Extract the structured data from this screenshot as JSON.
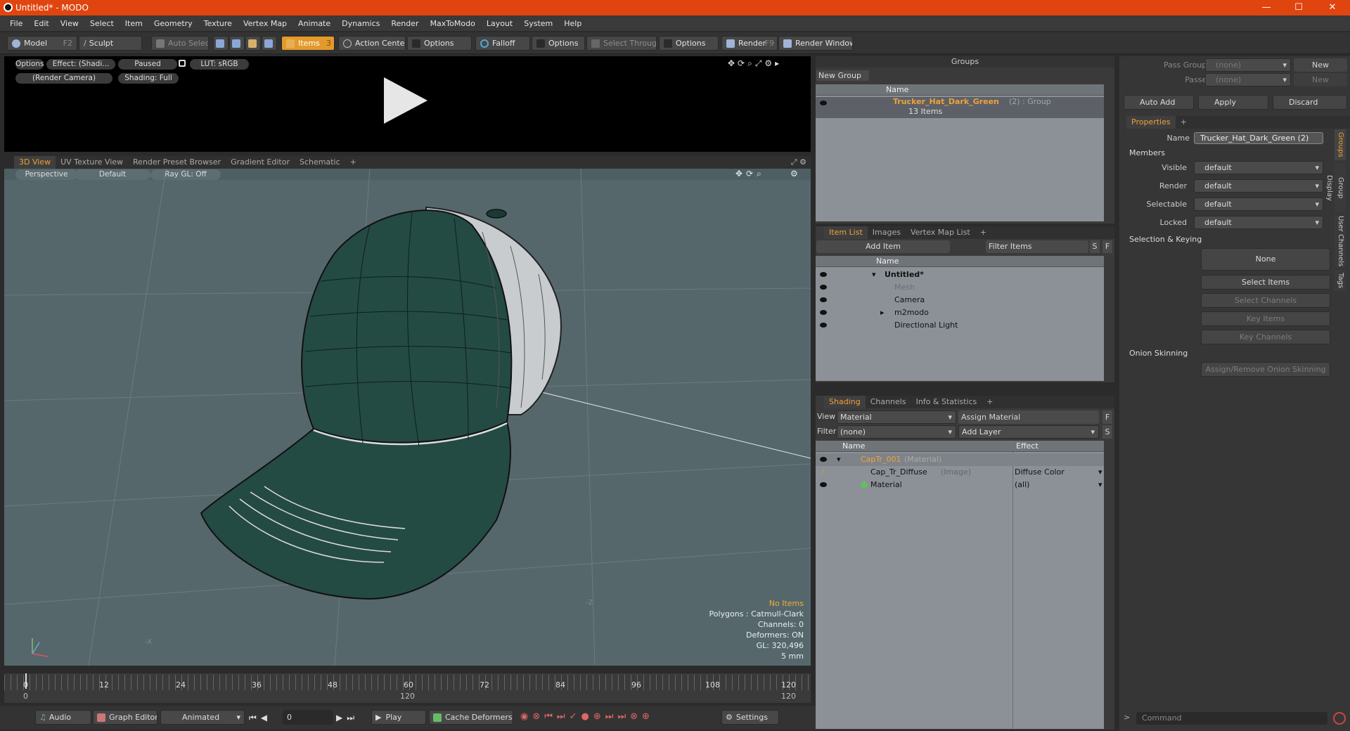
{
  "window": {
    "title": "Untitled* - MODO",
    "minimize": "—",
    "maximize": "☐",
    "close": "✕"
  },
  "menu": [
    "File",
    "Edit",
    "View",
    "Select",
    "Item",
    "Geometry",
    "Texture",
    "Vertex Map",
    "Animate",
    "Dynamics",
    "Render",
    "MaxToModo",
    "Layout",
    "System",
    "Help"
  ],
  "toolbar": {
    "model": "Model",
    "model_key": "F2",
    "sculpt": "Sculpt",
    "auto_select": "Auto Select",
    "items": "Items",
    "items_key": "3",
    "action_center": "Action Center",
    "options1": "Options",
    "falloff": "Falloff",
    "options2": "Options",
    "select_through": "Select Through",
    "options3": "Options",
    "render": "Render",
    "render_key": "F9",
    "render_window": "Render Window"
  },
  "preview": {
    "options": "Options",
    "effect": "Effect: (Shadi...",
    "paused": "Paused",
    "lut": "LUT: sRGB",
    "camera": "(Render Camera)",
    "shading": "Shading: Full"
  },
  "viewtabs": [
    "3D View",
    "UV Texture View",
    "Render Preset Browser",
    "Gradient Editor",
    "Schematic",
    "+"
  ],
  "viewport": {
    "perspective": "Perspective",
    "default": "Default",
    "raygl": "Ray GL: Off",
    "info": {
      "no_items": "No Items",
      "polygons": "Polygons : Catmull-Clark",
      "channels": "Channels: 0",
      "deformers": "Deformers: ON",
      "gl": "GL: 320,496",
      "scale": "5 mm"
    },
    "axis_z": "-Z",
    "axis_x": "-X"
  },
  "timeline": {
    "ticks": [
      "0",
      "12",
      "24",
      "36",
      "48",
      "60",
      "72",
      "84",
      "96",
      "108",
      "120"
    ],
    "sub": [
      "0",
      "120",
      "120"
    ]
  },
  "bottombar": {
    "audio": "Audio",
    "graph_editor": "Graph Editor",
    "animated": "Animated",
    "frame": "0",
    "play": "Play",
    "cache_deformers": "Cache Deformers",
    "settings": "Settings"
  },
  "groups": {
    "title": "Groups",
    "new_group": "New Group",
    "col_name": "Name",
    "item_name": "Trucker_Hat_Dark_Green",
    "item_suffix": "(2) : Group",
    "item_count": "13 Items"
  },
  "itemlist": {
    "tabs": [
      "Item List",
      "Images",
      "Vertex Map List",
      "+"
    ],
    "add_item": "Add Item",
    "filter": "Filter Items",
    "s": "S",
    "f": "F",
    "col_name": "Name",
    "rows": [
      "Untitled*",
      "Mesh",
      "Camera",
      "m2modo",
      "Directional Light"
    ]
  },
  "shading": {
    "tabs": [
      "Shading",
      "Channels",
      "Info & Statistics",
      "+"
    ],
    "view_label": "View",
    "view_value": "Material",
    "assign": "Assign Material",
    "f": "F",
    "filter_label": "Filter",
    "filter_value": "(none)",
    "add_layer": "Add Layer",
    "s": "S",
    "col_name": "Name",
    "col_effect": "Effect",
    "rows": [
      {
        "name": "CapTr_001",
        "suffix": "(Material)",
        "effect": ""
      },
      {
        "name": "Cap_Tr_Diffuse",
        "suffix": "(Image)",
        "effect": "Diffuse Color"
      },
      {
        "name": "Material",
        "suffix": "",
        "effect": "(all)"
      }
    ]
  },
  "props": {
    "pass_groups": "Pass Groups",
    "passes": "Passes",
    "none": "(none)",
    "new": "New",
    "auto_add": "Auto Add",
    "apply": "Apply",
    "discard": "Discard",
    "tab": "Properties",
    "plus": "+",
    "name_label": "Name",
    "name_value": "Trucker_Hat_Dark_Green (2)",
    "members": "Members",
    "visible": "Visible",
    "render": "Render",
    "selectable": "Selectable",
    "locked": "Locked",
    "default": "default",
    "sel_keying": "Selection & Keying",
    "sel_none": "None",
    "select_items": "Select Items",
    "select_channels": "Select Channels",
    "key_items": "Key Items",
    "key_channels": "Key Channels",
    "onion": "Onion Skinning",
    "assign_onion": "Assign/Remove Onion Skinning",
    "vtabs": [
      "Groups",
      "Group Display",
      "User Channels",
      "Tags"
    ],
    "command": "Command"
  },
  "colors": {
    "accent": "#e39a2b",
    "title": "#e0450f",
    "viewport": "#56676c",
    "cap": "#244a44"
  }
}
